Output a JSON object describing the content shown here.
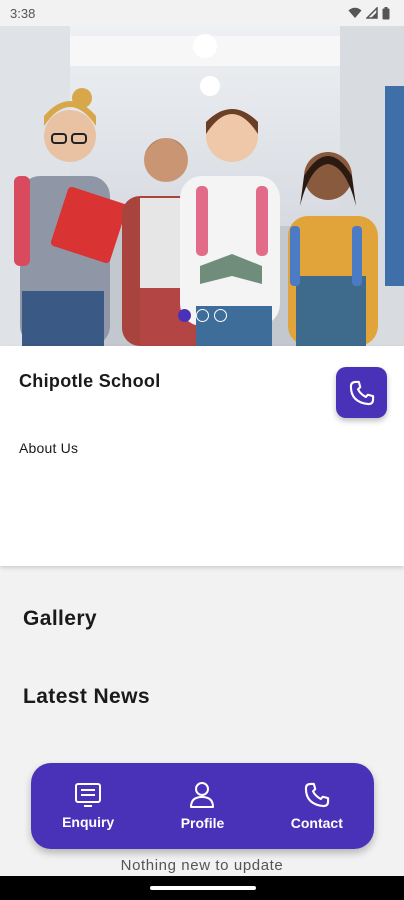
{
  "status_bar": {
    "time": "3:38"
  },
  "hero": {
    "slide_count": 3,
    "active_slide": 1
  },
  "school": {
    "name": "Chipotle School",
    "about_label": "About Us"
  },
  "sections": {
    "gallery_title": "Gallery",
    "news_title": "Latest News"
  },
  "bottom_nav": {
    "items": [
      {
        "label": "Enquiry",
        "icon": "enquiry-icon"
      },
      {
        "label": "Profile",
        "icon": "profile-icon"
      },
      {
        "label": "Contact",
        "icon": "phone-icon"
      }
    ]
  },
  "news": {
    "empty_message": "Nothing new to update"
  },
  "colors": {
    "accent": "#4a32b8",
    "background": "#f2f2f2",
    "card": "#ffffff"
  }
}
